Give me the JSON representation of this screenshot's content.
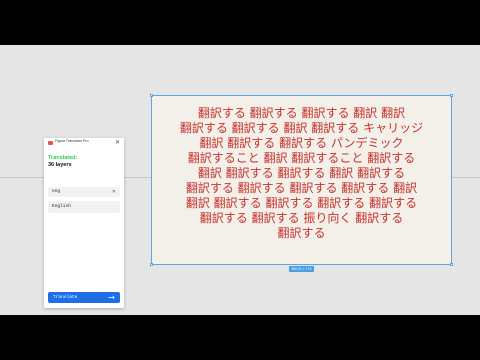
{
  "plugin": {
    "title": "Figma Translator Pro",
    "status": "Translated:",
    "layers": "36 layers",
    "search": {
      "value": "eng"
    },
    "language_option": "English",
    "translate_label": "Translate",
    "icons": {
      "logo": "logo-icon",
      "close": "close-icon",
      "clear": "clear-icon",
      "arrow": "arrow-right-icon"
    }
  },
  "frame": {
    "lines": [
      "翻訳する 翻訳する 翻訳する 翻訳 翻訳",
      "翻訳する 翻訳する 翻訳 翻訳する キャリッジ",
      "翻訳 翻訳する 翻訳する パンデミック",
      "翻訳すること 翻訳 翻訳すること 翻訳する",
      "翻訳 翻訳する 翻訳する 翻訳 翻訳する",
      "翻訳する 翻訳する 翻訳する 翻訳する 翻訳",
      "翻訳 翻訳する 翻訳する 翻訳する 翻訳する",
      "翻訳する 翻訳する 振り向く 翻訳する",
      "翻訳する"
    ],
    "size_badge": "300.21 × 174",
    "text_color": "#c8322c",
    "selection_color": "#5aa7e6"
  }
}
